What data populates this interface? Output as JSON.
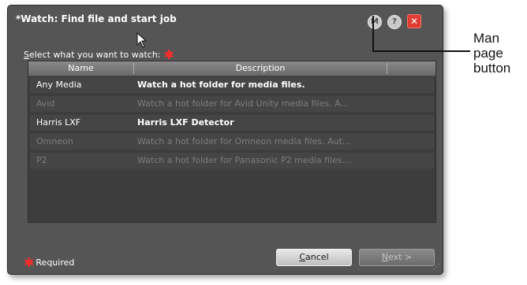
{
  "dialog": {
    "title": "*Watch: Find file and start job",
    "buttons": {
      "man": "M",
      "help": "?",
      "close": "✕"
    },
    "prompt": {
      "underlined_letter": "S",
      "rest": "elect what you want to watch:"
    },
    "required_marker": "✱",
    "list": {
      "columns": [
        "Name",
        "Description"
      ],
      "rows": [
        {
          "name": "Any Media",
          "description": "Watch a hot folder for media files.",
          "enabled": true
        },
        {
          "name": "Avid",
          "description": "Watch a hot folder for Avid Unity media files. A...",
          "enabled": false
        },
        {
          "name": "Harris LXF",
          "description": "Harris LXF Detector",
          "enabled": true
        },
        {
          "name": "Omneon",
          "description": "Watch a hot folder for Omneon media files. Aut...",
          "enabled": false
        },
        {
          "name": "P2",
          "description": "Watch a hot folder for Panasonic P2 media files....",
          "enabled": false
        }
      ]
    },
    "footer": {
      "required_label": "Required",
      "cancel": {
        "underlined_letter": "C",
        "rest": "ancel"
      },
      "next": {
        "underlined_letter": "N",
        "rest": "ext >"
      }
    }
  },
  "callout": {
    "lines": [
      "Man",
      "page",
      "button"
    ]
  },
  "colors": {
    "dialog_bg": "#555555",
    "list_bg": "#3d3d3d",
    "required_star": "#ff2a2a",
    "close_button": "#e23c32"
  },
  "icons": [
    "man-page-icon",
    "help-icon",
    "close-icon",
    "mouse-cursor-icon",
    "resize-grip-icon"
  ]
}
